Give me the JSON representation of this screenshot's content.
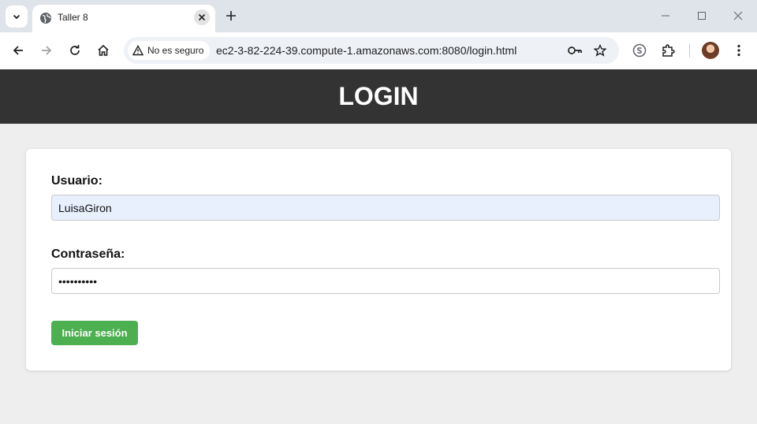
{
  "browser": {
    "tab": {
      "title": "Taller 8"
    },
    "address": {
      "security_label": "No es seguro",
      "url": "ec2-3-82-224-39.compute-1.amazonaws.com:8080/login.html"
    }
  },
  "page": {
    "header_title": "LOGIN",
    "form": {
      "username_label": "Usuario:",
      "username_value": "LuisaGiron",
      "password_label": "Contraseña:",
      "password_value": "••••••••••",
      "submit_label": "Iniciar sesión"
    }
  },
  "colors": {
    "header_bg": "#333333",
    "button_bg": "#4caf50",
    "autofill_bg": "#e8f0fe"
  }
}
